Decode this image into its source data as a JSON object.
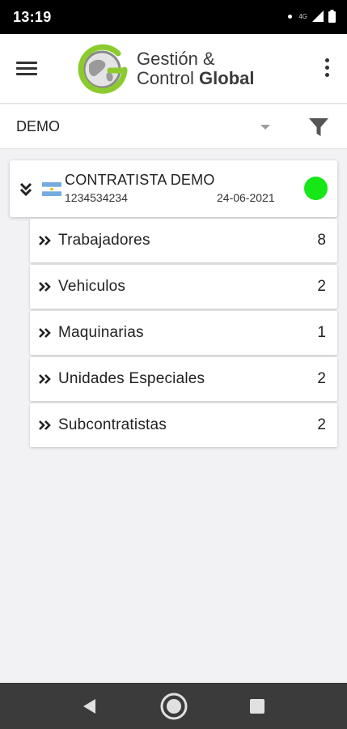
{
  "status_bar": {
    "time": "13:19",
    "network": "4G",
    "icons": [
      "notification-dot-icon",
      "signal-icon",
      "battery-icon"
    ]
  },
  "header": {
    "logo_line1": "Gestión &",
    "logo_line2_regular": "Control ",
    "logo_line2_bold": "Global",
    "icons": [
      "menu-icon",
      "more-vertical-icon"
    ],
    "colors": {
      "logo_green": "#8ccb2e",
      "logo_grey": "#8a8a8a"
    }
  },
  "filter": {
    "selected_company": "DEMO",
    "icons": [
      "dropdown-caret-icon",
      "filter-icon"
    ]
  },
  "contractor": {
    "name": "CONTRATISTA DEMO",
    "id": "1234534234",
    "date": "24-06-2021",
    "flag": "argentina-flag-icon",
    "status_color": "#17e617"
  },
  "categories": [
    {
      "label": "Trabajadores",
      "count": "8"
    },
    {
      "label": "Vehiculos",
      "count": "2"
    },
    {
      "label": "Maquinarias",
      "count": "1"
    },
    {
      "label": "Unidades Especiales",
      "count": "2"
    },
    {
      "label": "Subcontratistas",
      "count": "2"
    }
  ],
  "nav": {
    "icons": [
      "back-icon",
      "home-icon",
      "recents-icon"
    ]
  }
}
